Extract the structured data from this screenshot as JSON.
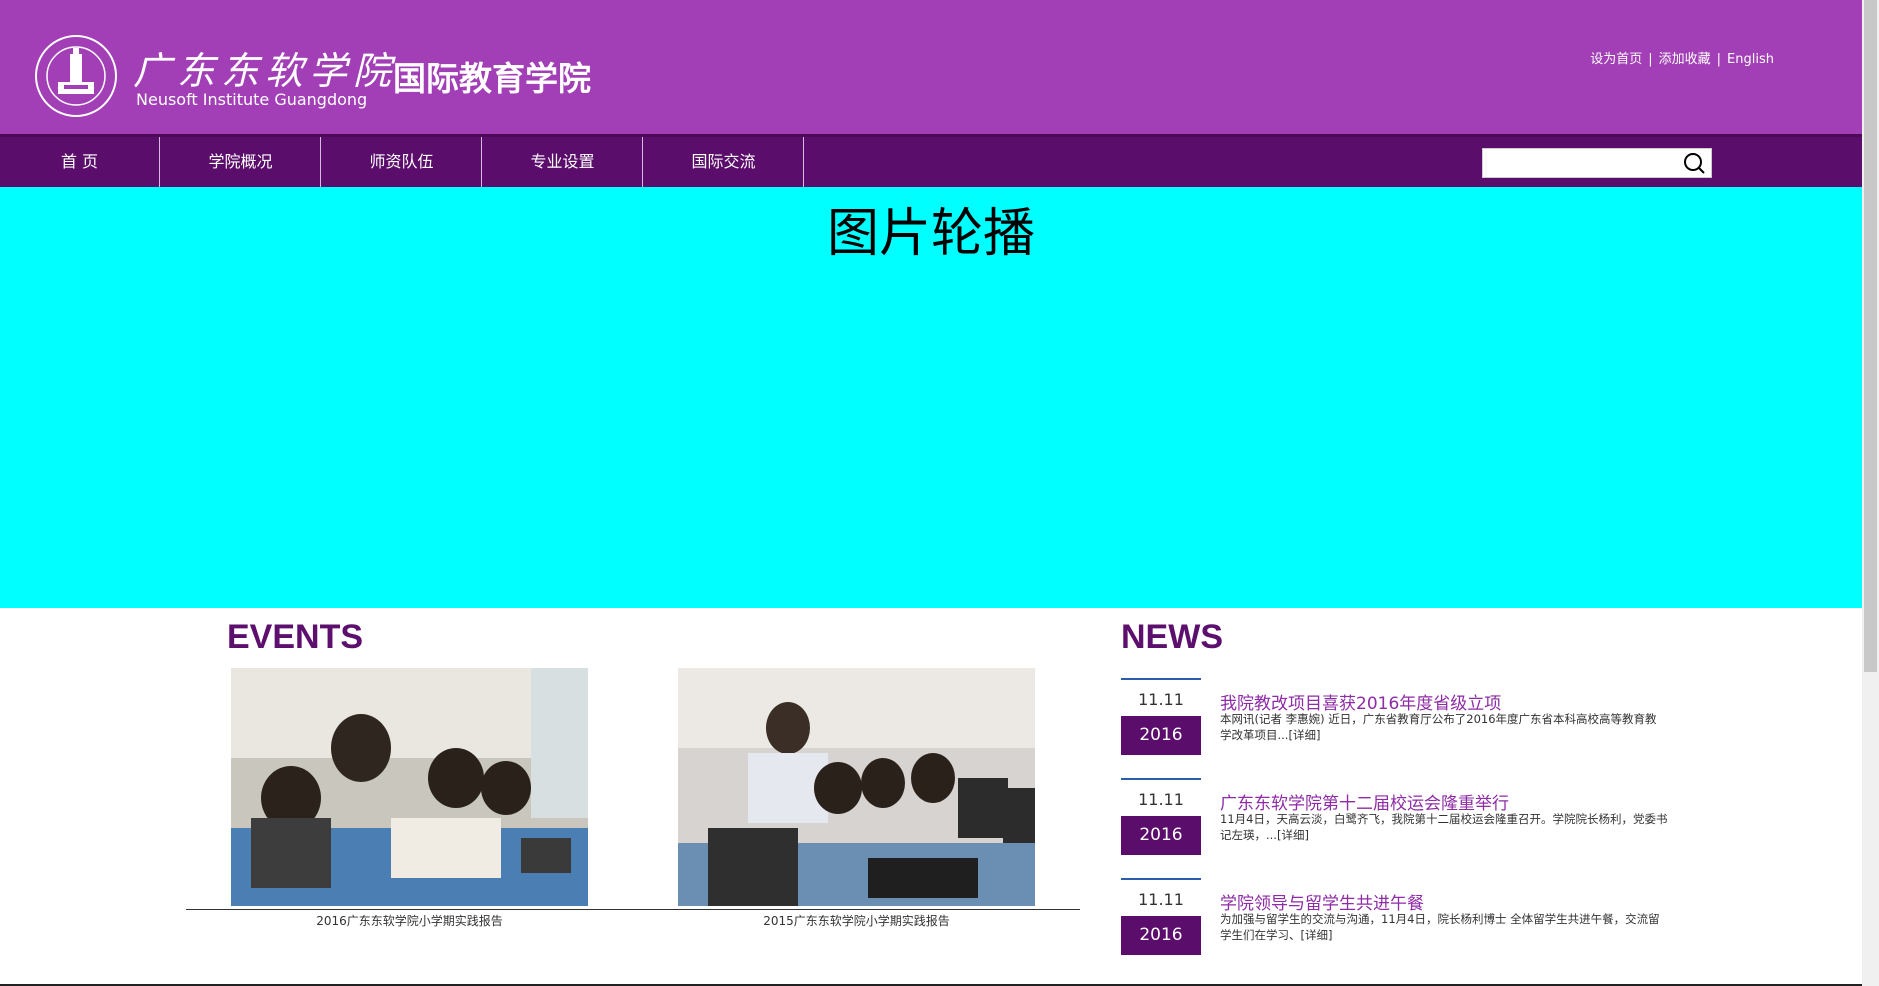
{
  "header": {
    "logo_cn": "广东东软学院",
    "logo_en": "Neusoft Institute Guangdong",
    "college_title": "国际教育学院",
    "top_links": [
      "设为首页",
      "添加收藏",
      "English"
    ]
  },
  "nav": {
    "items": [
      "首 页",
      "学院概况",
      "师资队伍",
      "专业设置",
      "国际交流"
    ],
    "search_placeholder": ""
  },
  "carousel": {
    "label": "图片轮播",
    "background": "#00ffff"
  },
  "events": {
    "title": "EVENTS",
    "items": [
      {
        "caption": "2016广东东软学院小学期实践报告"
      },
      {
        "caption": "2015广东东软学院小学期实践报告"
      }
    ]
  },
  "news": {
    "title": "NEWS",
    "items": [
      {
        "day": "11.11",
        "year": "2016",
        "title": "我院教改项目喜获2016年度省级立项",
        "summary": "本网讯(记者 李惠婉) 近日，广东省教育厅公布了2016年度广东省本科高校高等教育教学改革项目...",
        "more": "[详细]"
      },
      {
        "day": "11.11",
        "year": "2016",
        "title": "广东东软学院第十二届校运会隆重举行",
        "summary": "11月4日，天高云淡，白鹭齐飞，我院第十二届校运会隆重召开。学院院长杨利，党委书记左瑛，...",
        "more": "[详细]"
      },
      {
        "day": "11.11",
        "year": "2016",
        "title": "学院领导与留学生共进午餐",
        "summary": "为加强与留学生的交流与沟通，11月4日，院长杨利博士 全体留学生共进午餐，交流留学生们在学习、",
        "more": "[详细]"
      }
    ]
  },
  "colors": {
    "header_bg": "#a23fb6",
    "nav_bg": "#5b0d6b",
    "accent_title": "#5c0f6d",
    "news_link": "#8e2ba6"
  }
}
